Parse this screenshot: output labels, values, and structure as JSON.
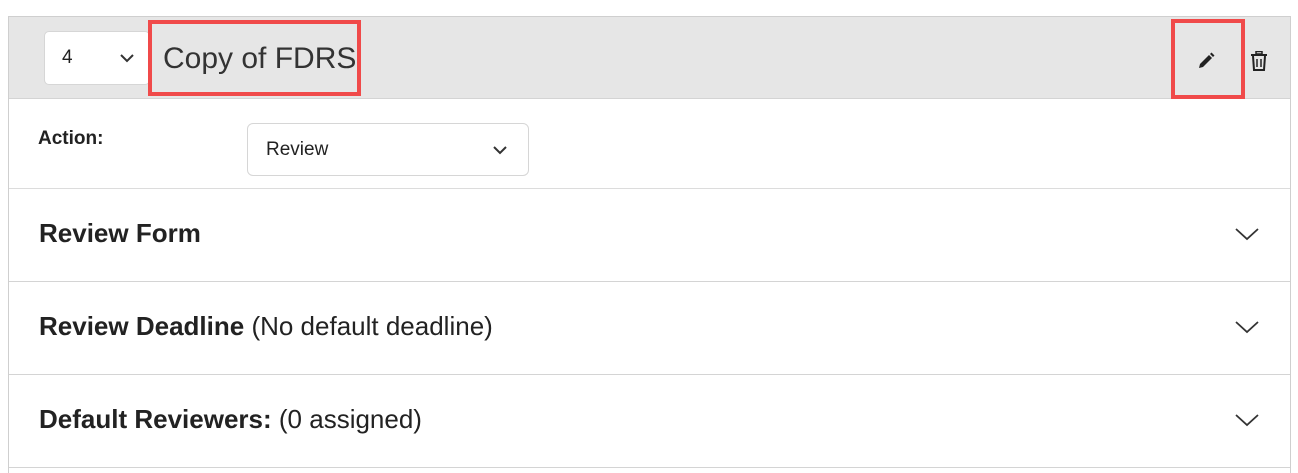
{
  "header": {
    "order_value": "4",
    "title": "Copy of FDRS",
    "icons": {
      "edit": "pencil-icon",
      "delete": "trash-icon",
      "dropdown": "chevron-down-icon"
    }
  },
  "action": {
    "label": "Action:",
    "selected": "Review"
  },
  "sections": [
    {
      "title": "Review Form",
      "detail": ""
    },
    {
      "title": "Review Deadline",
      "detail": "(No default deadline)"
    },
    {
      "title": "Default Reviewers:",
      "detail": "(0 assigned)"
    }
  ],
  "colors": {
    "highlight": "#f04a4a",
    "header_bg": "#e6e6e6"
  }
}
